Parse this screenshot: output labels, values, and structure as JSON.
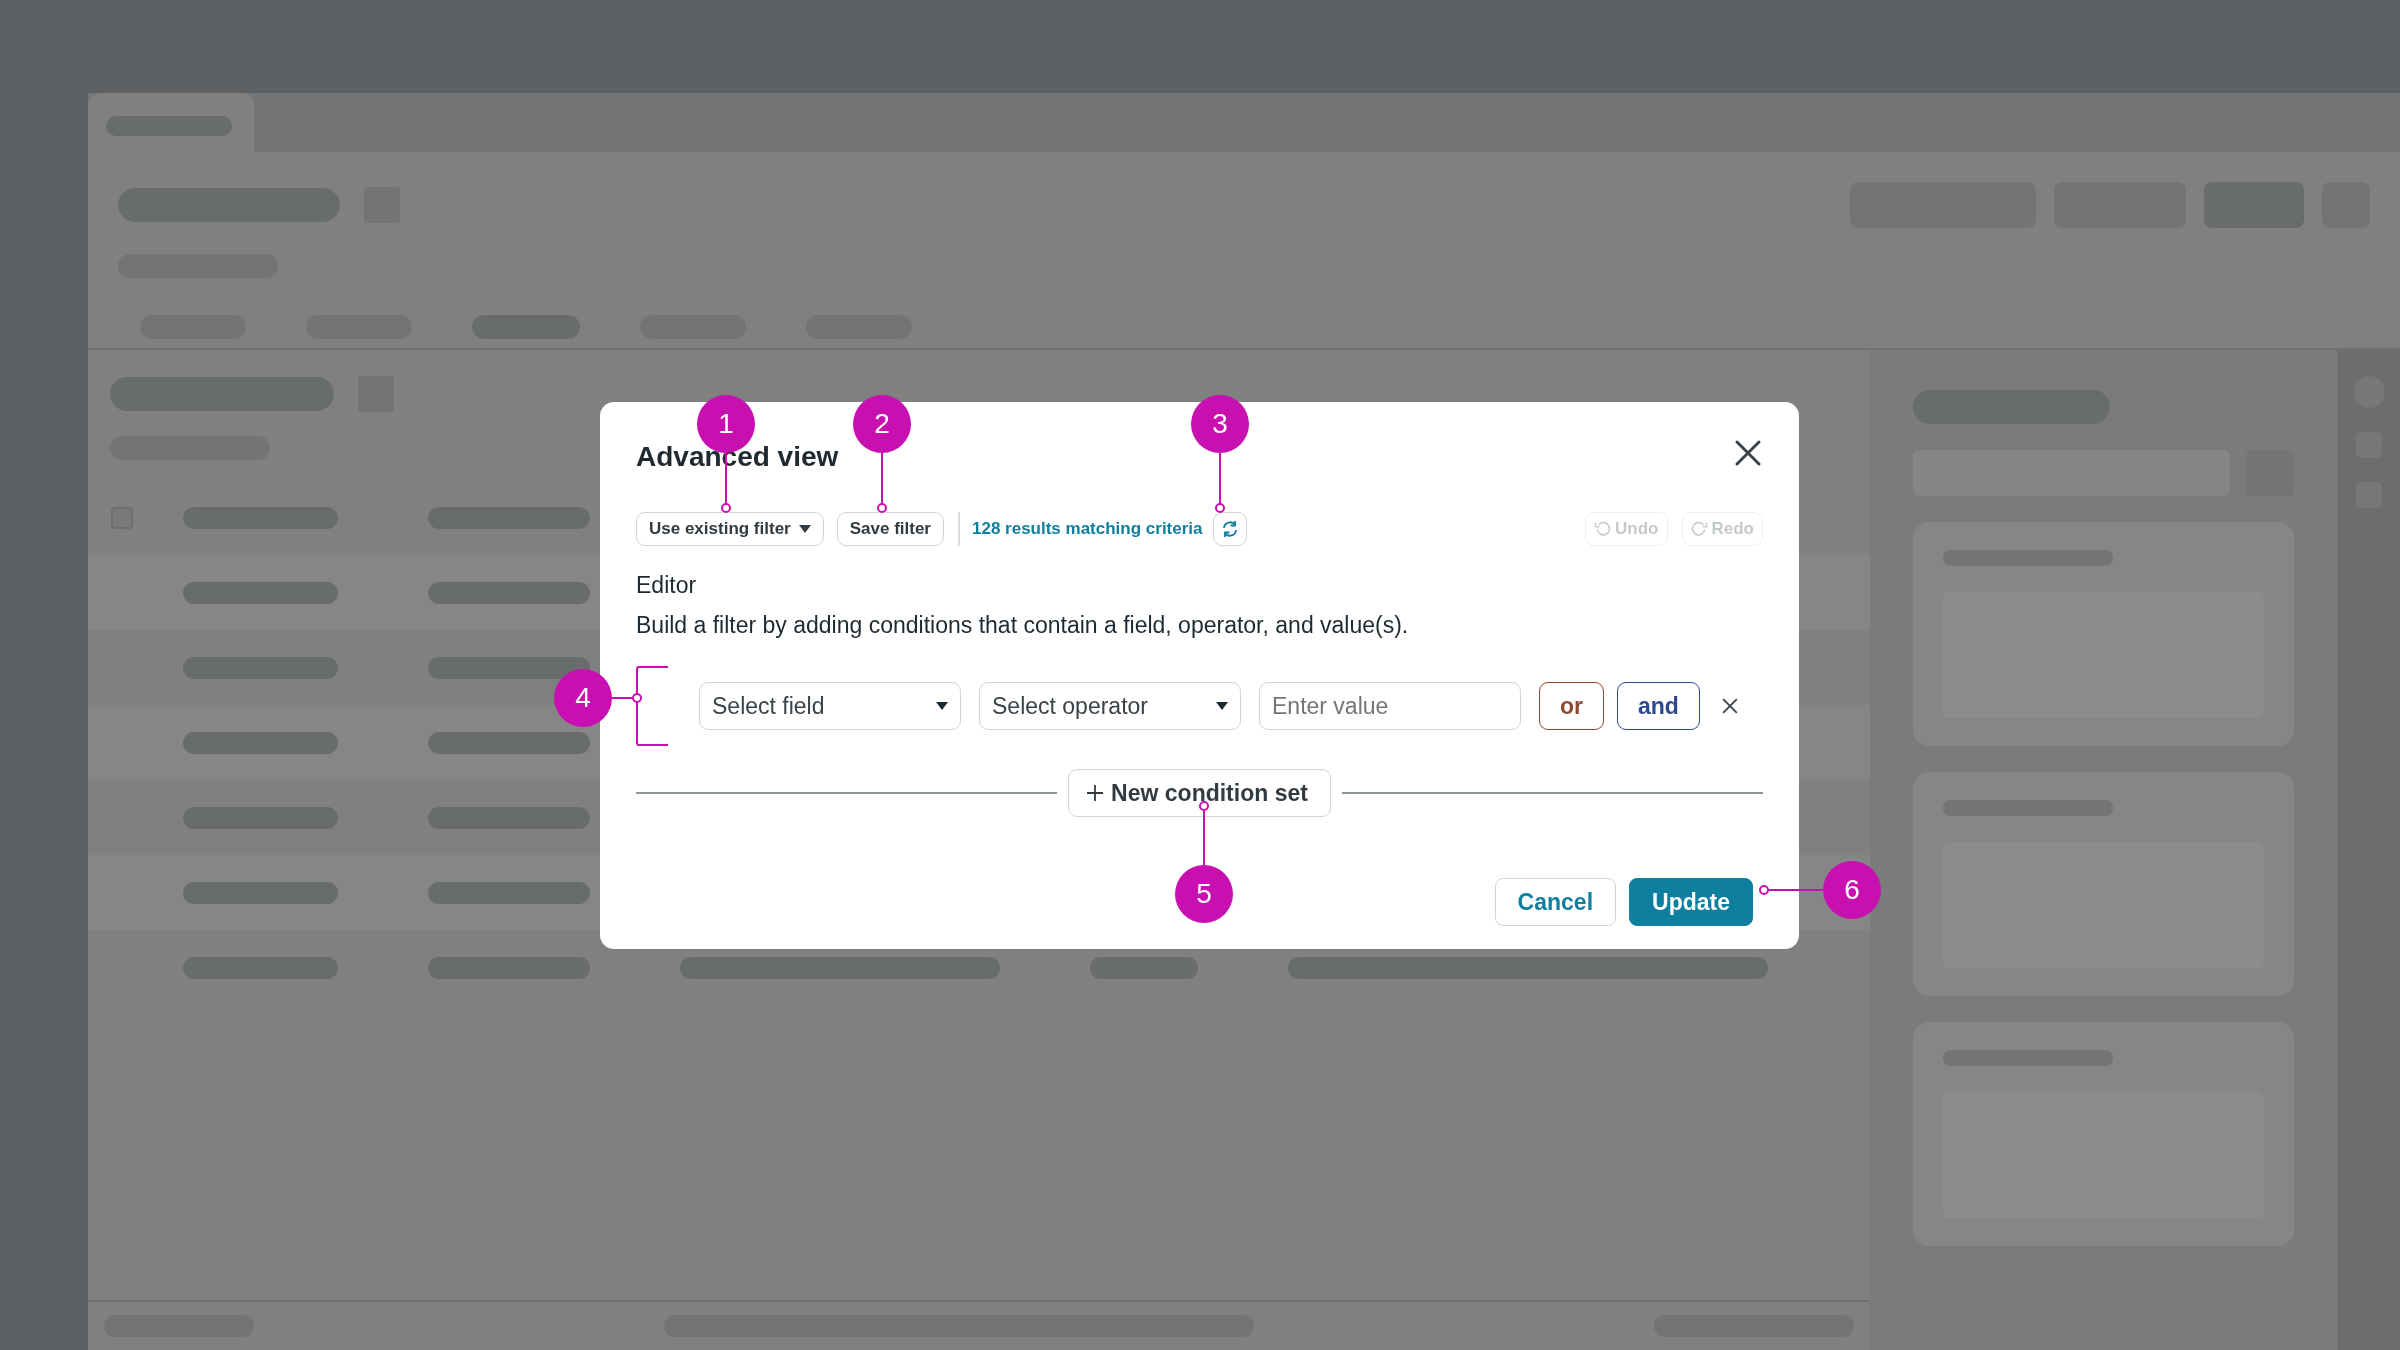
{
  "dialog": {
    "title": "Advanced view",
    "toolbar": {
      "buttons": [
        {
          "label": "Use existing filter",
          "kind": "dropdown"
        },
        {
          "label": "Save filter",
          "kind": "plain"
        }
      ],
      "results_link": "128 results matching criteria",
      "history": [
        {
          "label": "Undo",
          "kind": "undo",
          "disabled": true
        },
        {
          "label": "Redo",
          "kind": "redo",
          "disabled": true
        }
      ]
    },
    "editor": {
      "heading": "Editor",
      "description": "Build a filter by adding conditions that contain a field, operator, and value(s).",
      "conditions": [
        {
          "field_placeholder": "Select field",
          "operator_placeholder": "Select operator",
          "value_placeholder": "Enter value",
          "connectors": [
            {
              "label": "or",
              "color": "#8b4a2f"
            },
            {
              "label": "and",
              "color": "#2e4a8c"
            }
          ]
        }
      ],
      "new_set_button": "New condition set"
    },
    "footer": {
      "buttons": [
        {
          "label": "Cancel",
          "kind": "secondary"
        },
        {
          "label": "Update",
          "kind": "primary"
        }
      ]
    }
  },
  "annotations": [
    {
      "label": "1"
    },
    {
      "label": "2"
    },
    {
      "label": "3"
    },
    {
      "label": "4"
    },
    {
      "label": "5"
    },
    {
      "label": "6"
    }
  ]
}
